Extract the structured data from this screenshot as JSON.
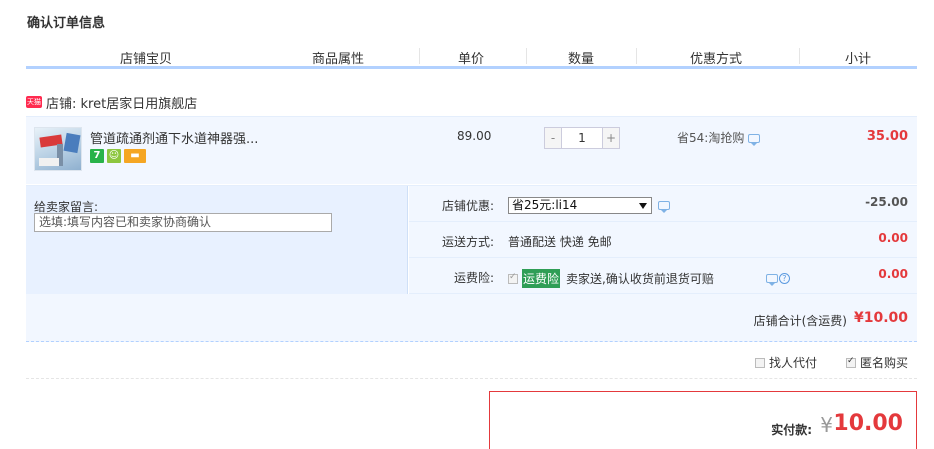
{
  "page_title": "确认订单信息",
  "table_header": {
    "shop_item": "店铺宝贝",
    "attributes": "商品属性",
    "unit_price": "单价",
    "quantity": "数量",
    "discount": "优惠方式",
    "subtotal": "小计"
  },
  "shop": {
    "badge": "天猫",
    "name": "店铺: kret居家日用旗舰店"
  },
  "item": {
    "name": "管道疏通剂通下水道神器强...",
    "badges": [
      "7",
      "",
      ""
    ],
    "price": "89.00",
    "qty_minus": "-",
    "qty_value": "1",
    "qty_plus": "+",
    "discount": "省54:淘抢购",
    "subtotal": "35.00"
  },
  "message": {
    "label": "给卖家留言:",
    "placeholder": "选填:填写内容已和卖家协商确认"
  },
  "shop_discount": {
    "label": "店铺优惠:",
    "selected": "省25元:li14",
    "amount": "-25.00"
  },
  "shipping": {
    "label": "运送方式:",
    "value": "普通配送 快递 免邮",
    "amount": "0.00"
  },
  "insurance": {
    "label": "运费险:",
    "tag": "运费险",
    "desc": "卖家送,确认收货前退货可赔",
    "amount": "0.00"
  },
  "shop_total": {
    "label": "店铺合计(含运费)",
    "amount": "¥10.00"
  },
  "options": {
    "proxy_pay": "找人代付",
    "anonymous": "匿名购买"
  },
  "payment": {
    "label": "实付款:",
    "currency": "¥",
    "amount": "10.00"
  }
}
